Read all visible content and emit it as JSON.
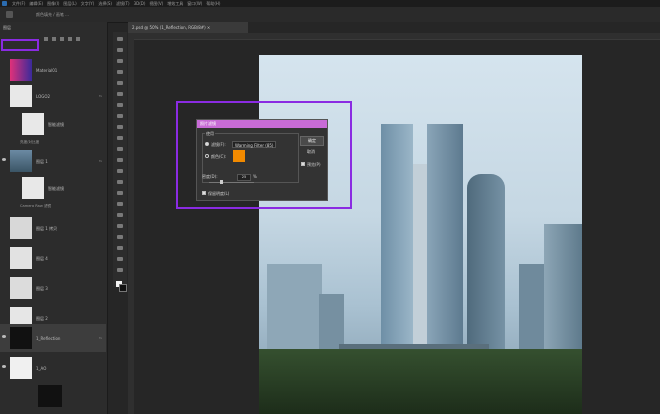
{
  "menubar": {
    "items": [
      "文件(F)",
      "编辑(E)",
      "图像(I)",
      "图层(L)",
      "文字(Y)",
      "选择(S)",
      "滤镜(T)",
      "3D(D)",
      "视图(V)",
      "增效工具",
      "窗口(W)",
      "帮助(H)"
    ]
  },
  "options_bar": {
    "field_text": "颜色填充 / 画笔 ..."
  },
  "layers_panel": {
    "title": "图层",
    "layers": [
      {
        "name": "Material01",
        "fx": ""
      },
      {
        "name": "LOGO2",
        "fx": "fx"
      },
      {
        "name": "智能滤镜",
        "fx": ""
      },
      {
        "name": "亮度/对比度",
        "fx": ""
      },
      {
        "name": "图层 1",
        "fx": "fx"
      },
      {
        "name": "智能滤镜",
        "fx": ""
      },
      {
        "name": "Camera Raw 滤镜",
        "fx": ""
      },
      {
        "name": "图层 1 拷贝",
        "fx": ""
      },
      {
        "name": "图层 4",
        "fx": ""
      },
      {
        "name": "图层 3",
        "fx": ""
      },
      {
        "name": "图层 2",
        "fx": ""
      },
      {
        "name": "1_Reflection",
        "fx": "fx"
      },
      {
        "name": "1_AO",
        "fx": ""
      }
    ]
  },
  "document": {
    "tab": "2.psd @ 50% (1_Reflection, RGB/8#) ×"
  },
  "dialog": {
    "title": "照片滤镜",
    "group_label": "使用",
    "filter_radio": "滤镜(F):",
    "filter_value": "Warming Filter (85)",
    "color_radio": "颜色(C):",
    "density_label": "密度(D):",
    "density_value": "25",
    "percent": "%",
    "preserve_luminosity": "保留明度(L)",
    "ok_label": "确定",
    "cancel_label": "取消",
    "preview_label": "预览(P)",
    "swatch_color": "#f28a00",
    "density_fraction": 0.25
  },
  "accent": {
    "highlight": "#8a2be2",
    "dialog_title": "#c86bd6"
  }
}
